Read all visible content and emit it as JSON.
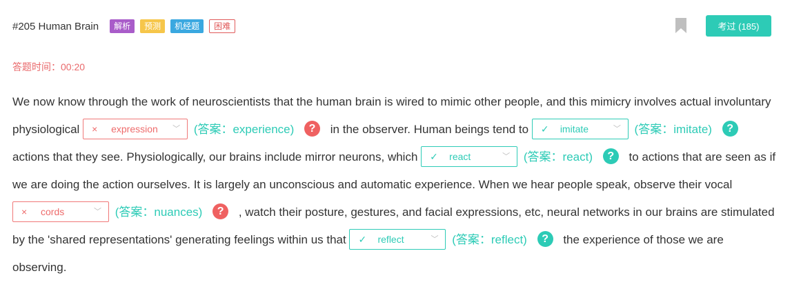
{
  "header": {
    "title": "#205 Human Brain",
    "tags": [
      "解析",
      "预测",
      "机经题",
      "困难"
    ],
    "exam_button": "考过 (185)"
  },
  "timer": "答题时间：00:20",
  "passage": {
    "t0": "We now know through the work of neuroscientists that the human brain is wired to mimic other people, and this mimicry involves actual involuntary physiological",
    "b1": {
      "value": "expression",
      "answer": "(答案：experience)",
      "status": "wrong"
    },
    "t1": "in the observer. Human beings tend to",
    "b2": {
      "value": "imitate",
      "answer": "(答案：imitate)",
      "status": "correct"
    },
    "t2": "actions that they see. Physiologically, our brains include mirror neurons, which",
    "b3": {
      "value": "react",
      "answer": "(答案：react)",
      "status": "correct"
    },
    "t3": "to actions that are seen as if we are doing the action ourselves. It is largely an unconscious and automatic experience. When we hear people speak, observe their vocal",
    "b4": {
      "value": "cords",
      "answer": "(答案：nuances)",
      "status": "wrong"
    },
    "t4": ", watch their posture, gestures, and facial expressions, etc, neural networks in our brains are stimulated by the 'shared representations' generating feelings within us that",
    "b5": {
      "value": "reflect",
      "answer": "(答案：reflect)",
      "status": "correct"
    },
    "t5": "the experience of those we are observing."
  },
  "icons": {
    "wrong": "×",
    "correct": "✓",
    "chevron": "﹀",
    "help": "?"
  },
  "colors": {
    "accent": "#2dcbb6",
    "error": "#ef6161",
    "timer": "#e9696b"
  }
}
